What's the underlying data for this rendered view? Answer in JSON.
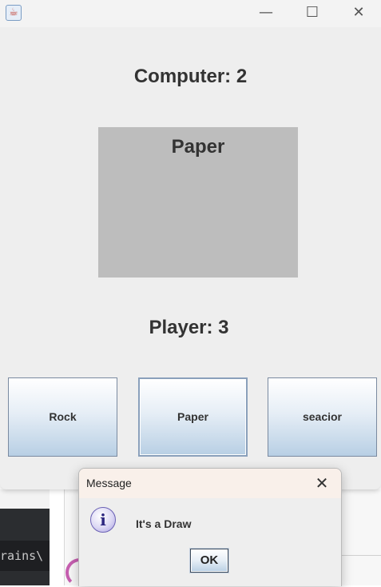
{
  "window": {
    "icon": "java-cup-icon",
    "controls": {
      "minimize": "—",
      "maximize": "☐",
      "close": "✕"
    }
  },
  "game": {
    "computer_score_label": "Computer: 2",
    "computer_choice": "Paper",
    "player_score_label": "Player: 3"
  },
  "buttons": {
    "rock": "Rock",
    "paper": "Paper",
    "scissor": "seacior"
  },
  "dialog": {
    "title": "Message",
    "close": "✕",
    "icon": "info-icon",
    "icon_glyph": "i",
    "message": "It's a Draw",
    "ok_label": "OK"
  },
  "background": {
    "terminal_text": "rains\\"
  },
  "colors": {
    "window_bg": "#eeeeee",
    "choice_panel_bg": "#bdbdbd",
    "text": "#333333",
    "dialog_titlebar": "#f9f0ea"
  }
}
